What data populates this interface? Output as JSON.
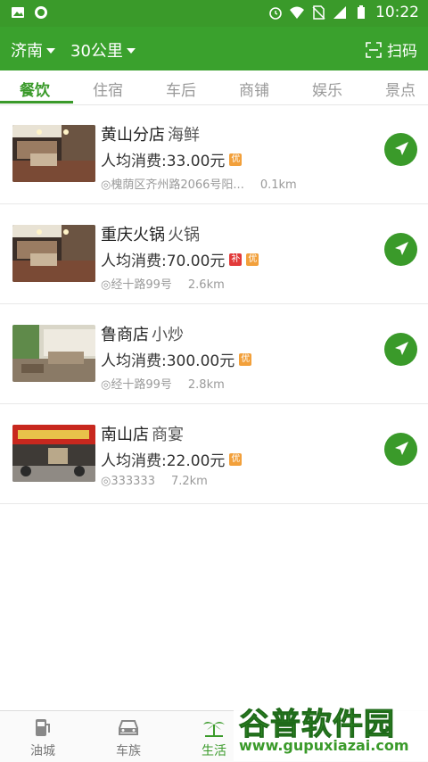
{
  "status_bar": {
    "time": "10:22"
  },
  "header": {
    "city": "济南",
    "distance": "30公里",
    "scan_label": "扫码"
  },
  "category_tabs": [
    {
      "label": "餐饮",
      "active": true
    },
    {
      "label": "住宿",
      "active": false
    },
    {
      "label": "车后",
      "active": false
    },
    {
      "label": "商铺",
      "active": false
    },
    {
      "label": "娱乐",
      "active": false
    },
    {
      "label": "景点",
      "active": false
    }
  ],
  "stores": [
    {
      "name": "黄山分店",
      "category": "海鲜",
      "avg_spend": "人均消费:33.00元",
      "badges": [
        "优"
      ],
      "address": "槐荫区齐州路2066号阳...",
      "distance": "0.1km"
    },
    {
      "name": "重庆火锅",
      "category": "火锅",
      "avg_spend": "人均消费:70.00元",
      "badges": [
        "补",
        "优"
      ],
      "address": "经十路99号",
      "distance": "2.6km"
    },
    {
      "name": "鲁商店",
      "category": "小炒",
      "avg_spend": "人均消费:300.00元",
      "badges": [
        "优"
      ],
      "address": "经十路99号",
      "distance": "2.8km"
    },
    {
      "name": "南山店",
      "category": "商宴",
      "avg_spend": "人均消费:22.00元",
      "badges": [
        "优"
      ],
      "address": "333333",
      "distance": "7.2km"
    }
  ],
  "bottom_nav": [
    {
      "label": "油城",
      "icon": "gas-station-icon"
    },
    {
      "label": "车族",
      "icon": "car-icon"
    },
    {
      "label": "生活",
      "icon": "palm-tree-icon",
      "active": true
    }
  ],
  "watermark": {
    "title": "谷普软件园",
    "url": "www.gupuxiazai.com"
  },
  "colors": {
    "brand_green": "#3aa12d",
    "badge_orange": "#f2a03b",
    "badge_red": "#e23a3a"
  }
}
